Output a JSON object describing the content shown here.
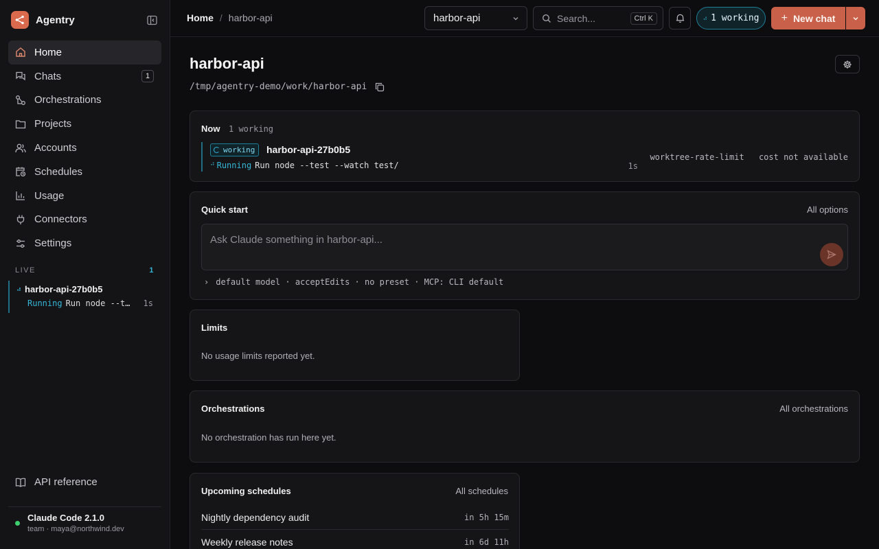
{
  "app": {
    "name": "Agentry"
  },
  "nav": [
    {
      "label": "Home",
      "icon": "home-icon",
      "active": true
    },
    {
      "label": "Chats",
      "icon": "chat-icon",
      "badge": "1"
    },
    {
      "label": "Orchestrations",
      "icon": "orchestration-icon"
    },
    {
      "label": "Projects",
      "icon": "folder-icon"
    },
    {
      "label": "Accounts",
      "icon": "users-icon"
    },
    {
      "label": "Schedules",
      "icon": "calendar-clock-icon"
    },
    {
      "label": "Usage",
      "icon": "bar-chart-icon"
    },
    {
      "label": "Connectors",
      "icon": "plug-icon"
    },
    {
      "label": "Settings",
      "icon": "sliders-icon"
    }
  ],
  "live": {
    "heading": "LIVE",
    "count": "1",
    "items": [
      {
        "title": "harbor-api-27b0b5",
        "status": "Running",
        "command": "Run node --test --watch test/",
        "elapsed": "1s"
      }
    ]
  },
  "footer": {
    "api_reference": "API reference",
    "version": "Claude Code 2.1.0",
    "account": "team · maya@northwind.dev"
  },
  "topbar": {
    "breadcrumb_home": "Home",
    "breadcrumb_sep": "/",
    "breadcrumb_current": "harbor-api",
    "project_select": "harbor-api",
    "search_placeholder": "Search...",
    "search_shortcut": "Ctrl K",
    "working_pill": "1 working",
    "new_chat": "New chat"
  },
  "page": {
    "title": "harbor-api",
    "path": "/tmp/agentry-demo/work/harbor-api"
  },
  "now": {
    "title": "Now",
    "count": "1 working",
    "session": {
      "badge": "working",
      "name": "harbor-api-27b0b5",
      "status": "Running",
      "command": "Run node --test --watch test/",
      "elapsed": "1s",
      "worktree": "worktree-rate-limit",
      "cost": "cost not available"
    }
  },
  "quick_start": {
    "title": "Quick start",
    "link": "All options",
    "placeholder": "Ask Claude something in harbor-api...",
    "options": "default model · acceptEdits · no preset · MCP: CLI default"
  },
  "limits": {
    "title": "Limits",
    "empty": "No usage limits reported yet."
  },
  "orchestrations": {
    "title": "Orchestrations",
    "link": "All orchestrations",
    "empty": "No orchestration has run here yet."
  },
  "schedules": {
    "title": "Upcoming schedules",
    "link": "All schedules",
    "items": [
      {
        "name": "Nightly dependency audit",
        "when": "in 5h 15m"
      },
      {
        "name": "Weekly release notes",
        "when": "in 6d 11h"
      }
    ]
  },
  "colors": {
    "accent": "#c8604a",
    "live": "#35b7d8",
    "online": "#3ecf6e",
    "background": "#0d0d0f"
  }
}
